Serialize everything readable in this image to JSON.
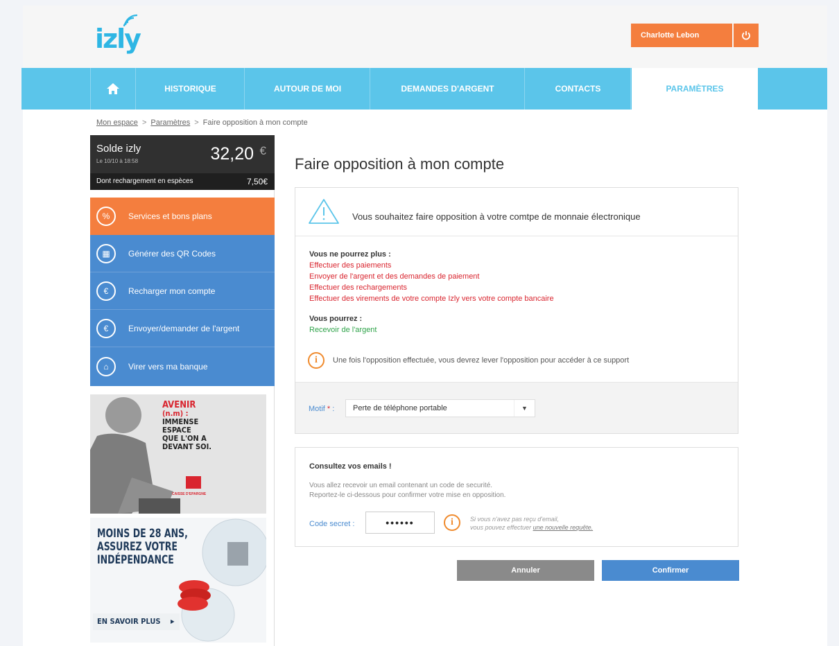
{
  "header": {
    "logo_text": "izly",
    "user_name": "Charlotte Lebon"
  },
  "nav": {
    "items": [
      {
        "label": "HISTORIQUE"
      },
      {
        "label": "AUTOUR DE MOI"
      },
      {
        "label": "DEMANDES D'ARGENT"
      },
      {
        "label": "CONTACTS"
      },
      {
        "label": "PARAMÈTRES"
      }
    ],
    "active": "PARAMÈTRES"
  },
  "breadcrumb": {
    "items": [
      "Mon espace",
      "Paramètres",
      "Faire opposition à mon compte"
    ],
    "separator": ">"
  },
  "sidebar": {
    "balance_label": "Solde izly",
    "balance_date": "Le 10/10 à 18:58",
    "balance_amount": "32,20",
    "currency": "€",
    "cash_label": "Dont rechargement en espèces",
    "cash_value": "7,50€",
    "menu": [
      {
        "label": "Services et bons plans",
        "icon": "percent-icon",
        "glyph": "%"
      },
      {
        "label": "Générer des QR Codes",
        "icon": "qr-code-icon",
        "glyph": "▦"
      },
      {
        "label": "Recharger mon compte",
        "icon": "euro-refresh-icon",
        "glyph": "€"
      },
      {
        "label": "Envoyer/demander de l'argent",
        "icon": "euro-icon",
        "glyph": "€"
      },
      {
        "label": "Virer vers ma banque",
        "icon": "bank-icon",
        "glyph": "⌂"
      }
    ]
  },
  "ads": {
    "ad1": {
      "lines": [
        "AVENIR",
        "(n.m) :",
        "IMMENSE",
        "ESPACE",
        "QUE L'ON A",
        "DEVANT SOI."
      ],
      "brand": "CAISSE D'EPARGNE"
    },
    "ad2": {
      "lines": [
        "MOINS DE 28 ANS,",
        "ASSUREZ VOTRE",
        "INDÉPENDANCE"
      ],
      "cta": "EN SAVOIR PLUS"
    }
  },
  "main": {
    "title": "Faire opposition à mon compte",
    "warning": "Vous souhaitez faire opposition à votre comtpe de monnaie électronique",
    "cannot_title": "Vous ne pourrez plus :",
    "cannot_items": [
      "Effectuer des paiements",
      "Envoyer de l'argent et des demandes de paiement",
      "Effectuer des rechargements",
      "Effectuer des virements de votre compte Izly vers votre compte bancaire"
    ],
    "can_title": "Vous pourrez :",
    "can_items": [
      "Recevoir de l'argent"
    ],
    "info": "Une fois l'opposition effectuée, vous devrez lever l'opposition pour accéder à ce support",
    "motif_label": "Motif",
    "motif_required": "*",
    "motif_sep": ":",
    "motif_value": "Perte de téléphone portable"
  },
  "email_card": {
    "title": "Consultez vos emails !",
    "text1": "Vous allez recevoir un email contenant un code de securité.",
    "text2": "Reportez-le ci-dessous pour confirmer votre mise en opposition.",
    "code_label": "Code secret :",
    "code_value": "••••••",
    "note1": "Si vous n'avez pas reçu d'email,",
    "note2_prefix": "vous pouvez effectuer ",
    "note2_link": "une nouvelle requête."
  },
  "buttons": {
    "cancel": "Annuler",
    "confirm": "Confirmer"
  },
  "colors": {
    "brand_blue": "#5bc5ea",
    "orange": "#f47e3e",
    "menu_blue": "#4a8bd0",
    "red": "#d9252f",
    "green": "#2fa34a"
  }
}
